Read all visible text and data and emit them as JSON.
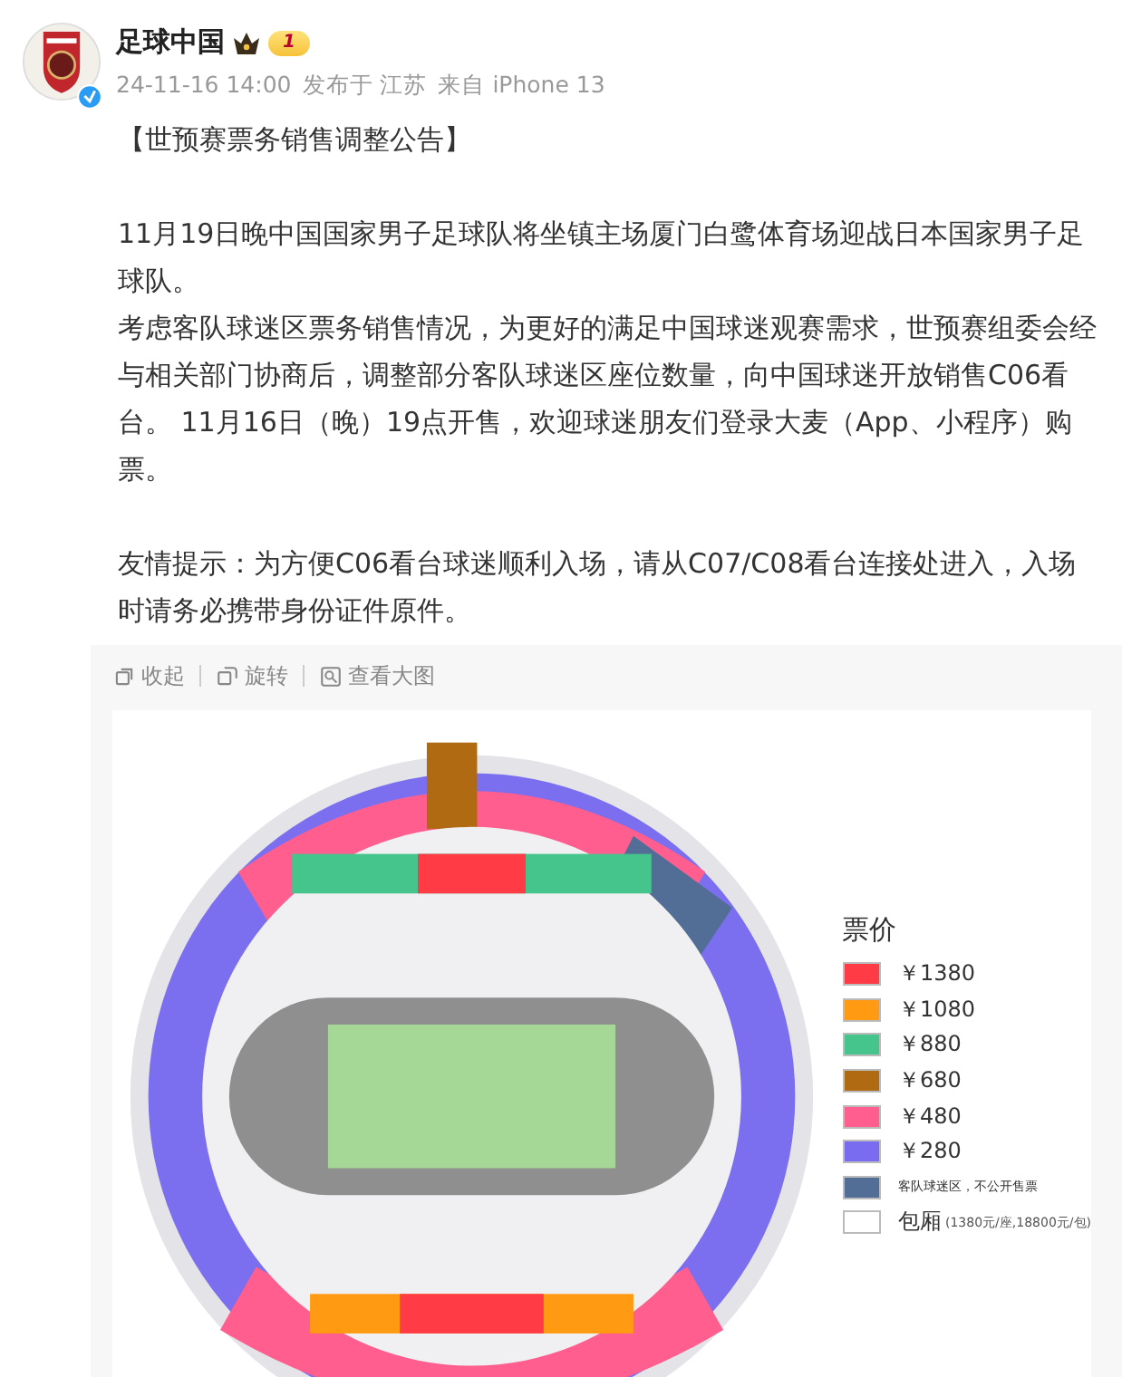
{
  "post": {
    "author": "足球中国",
    "badge_level": "1",
    "verified": true,
    "time": "24-11-16 14:00",
    "location": "发布于 江苏",
    "source": "来自 iPhone 13",
    "blocks": [
      [
        "【世预赛票务销售调整公告】"
      ],
      [
        "11月19日晚中国国家男子足球队将坐镇主场厦门白鹭体育场迎战日本国家男子足球队。",
        "考虑客队球迷区票务销售情况，为更好的满足中国球迷观赛需求，世预赛组委会经与相关部门协商后，调整部分客队球迷区座位数量，向中国球迷开放销售C06看台。 11月16日（晚）19点开售，欢迎球迷朋友们登录大麦（App、小程序）购票。"
      ],
      [
        "友情提示：为方便C06看台球迷顺利入场，请从C07/C08看台连接处进入，入场时请务必携带身份证件原件。"
      ]
    ]
  },
  "image_toolbar": [
    {
      "kind": "collapse",
      "label": "收起"
    },
    {
      "kind": "rotate",
      "label": "旋转"
    },
    {
      "kind": "view",
      "label": "查看大图"
    }
  ],
  "legend": {
    "title": "票价",
    "items": [
      {
        "label": "￥1380",
        "color": "#ff3b45"
      },
      {
        "label": "￥1080",
        "color": "#ff9a12"
      },
      {
        "label": "￥880",
        "color": "#45c48c"
      },
      {
        "label": "￥680",
        "color": "#b06a12"
      },
      {
        "label": "￥480",
        "color": "#ff5e8e"
      },
      {
        "label": "￥280",
        "color": "#7a6cf0"
      },
      {
        "label": "客队球迷区，不公开售票",
        "color": "#536e96",
        "small": true
      },
      {
        "label": "包厢",
        "note": "(1380元/座,18800元/包)",
        "color": "#ffffff"
      }
    ]
  }
}
